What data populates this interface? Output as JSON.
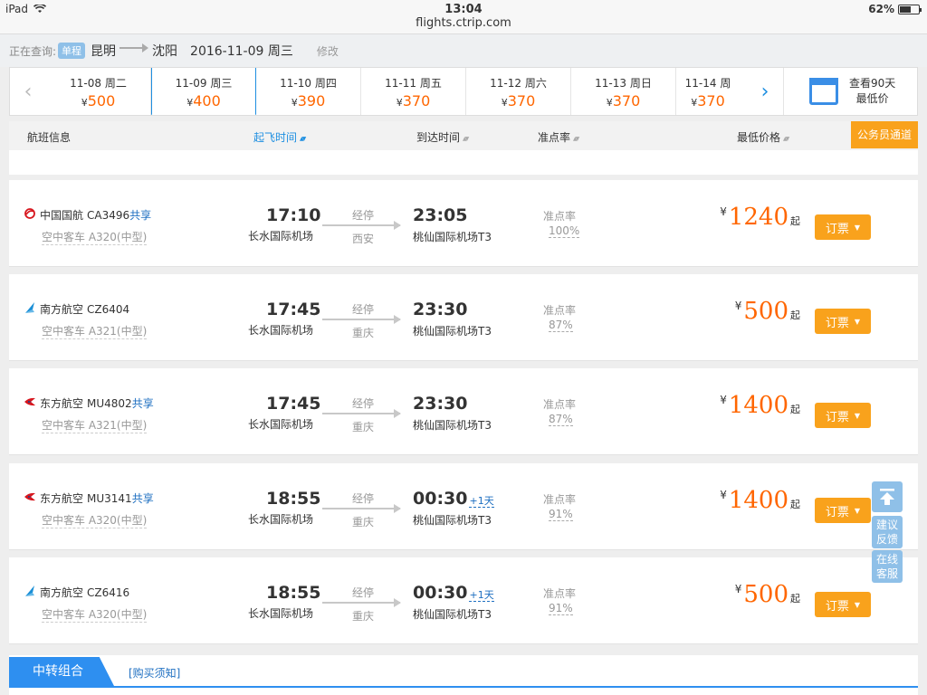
{
  "status": {
    "device": "iPad",
    "time": "13:04",
    "battery": "62%",
    "battery_level": 0.62,
    "url": "flights.ctrip.com"
  },
  "query": {
    "label": "正在查询:",
    "trip_type": "单程",
    "from": "昆明",
    "to": "沈阳",
    "date": "2016-11-09 周三",
    "edit": "修改"
  },
  "date_tabs": [
    {
      "date": "11-08 周二",
      "yen": "¥",
      "price": "500"
    },
    {
      "date": "11-09 周三",
      "yen": "¥",
      "price": "400",
      "active": true
    },
    {
      "date": "11-10 周四",
      "yen": "¥",
      "price": "390"
    },
    {
      "date": "11-11 周五",
      "yen": "¥",
      "price": "370"
    },
    {
      "date": "11-12 周六",
      "yen": "¥",
      "price": "370"
    },
    {
      "date": "11-13 周日",
      "yen": "¥",
      "price": "370"
    },
    {
      "date": "11-14 周",
      "yen": "¥",
      "price": "370"
    }
  ],
  "calendar": {
    "line1": "查看90天",
    "line2": "最低价"
  },
  "columns": {
    "info": "航班信息",
    "dep": "起飞时间",
    "arr": "到达时间",
    "punct": "准点率",
    "price": "最低价格",
    "gov": "公务员通道"
  },
  "flights": [
    {
      "airline": "中国国航",
      "fno": "CA3496",
      "share": "共享",
      "plane": "空中客车 A320(中型)",
      "dep_time": "17:10",
      "dep_airport": "长水国际机场",
      "stop_label": "经停",
      "stop_city": "西安",
      "arr_time": "23:05",
      "arr_plus": "",
      "arr_airport": "桃仙国际机场T3",
      "punct_label": "准点率",
      "punct": "100%",
      "yen": "¥",
      "price": "1240",
      "qi": "起",
      "book": "订票",
      "logo": "air-china-logo"
    },
    {
      "airline": "南方航空",
      "fno": "CZ6404",
      "share": "",
      "plane": "空中客车 A321(中型)",
      "dep_time": "17:45",
      "dep_airport": "长水国际机场",
      "stop_label": "经停",
      "stop_city": "重庆",
      "arr_time": "23:30",
      "arr_plus": "",
      "arr_airport": "桃仙国际机场T3",
      "punct_label": "准点率",
      "punct": "87%",
      "yen": "¥",
      "price": "500",
      "qi": "起",
      "book": "订票",
      "logo": "china-southern-logo"
    },
    {
      "airline": "东方航空",
      "fno": "MU4802",
      "share": "共享",
      "plane": "空中客车 A321(中型)",
      "dep_time": "17:45",
      "dep_airport": "长水国际机场",
      "stop_label": "经停",
      "stop_city": "重庆",
      "arr_time": "23:30",
      "arr_plus": "",
      "arr_airport": "桃仙国际机场T3",
      "punct_label": "准点率",
      "punct": "87%",
      "yen": "¥",
      "price": "1400",
      "qi": "起",
      "book": "订票",
      "logo": "china-eastern-logo"
    },
    {
      "airline": "东方航空",
      "fno": "MU3141",
      "share": "共享",
      "plane": "空中客车 A320(中型)",
      "dep_time": "18:55",
      "dep_airport": "长水国际机场",
      "stop_label": "经停",
      "stop_city": "重庆",
      "arr_time": "00:30",
      "arr_plus": "+1天",
      "arr_airport": "桃仙国际机场T3",
      "punct_label": "准点率",
      "punct": "91%",
      "yen": "¥",
      "price": "1400",
      "qi": "起",
      "book": "订票",
      "logo": "china-eastern-logo"
    },
    {
      "airline": "南方航空",
      "fno": "CZ6416",
      "share": "",
      "plane": "空中客车 A320(中型)",
      "dep_time": "18:55",
      "dep_airport": "长水国际机场",
      "stop_label": "经停",
      "stop_city": "重庆",
      "arr_time": "00:30",
      "arr_plus": "+1天",
      "arr_airport": "桃仙国际机场T3",
      "punct_label": "准点率",
      "punct": "91%",
      "yen": "¥",
      "price": "500",
      "qi": "起",
      "book": "订票",
      "logo": "china-southern-logo"
    }
  ],
  "side": {
    "feedback_l1": "建议",
    "feedback_l2": "反馈",
    "service_l1": "在线",
    "service_l2": "客服"
  },
  "transfer": {
    "tab": "中转组合",
    "link": "[购买须知]"
  },
  "colors": {
    "accent": "#1e8fe1",
    "price": "#ff6600",
    "button": "#f9a21c"
  }
}
